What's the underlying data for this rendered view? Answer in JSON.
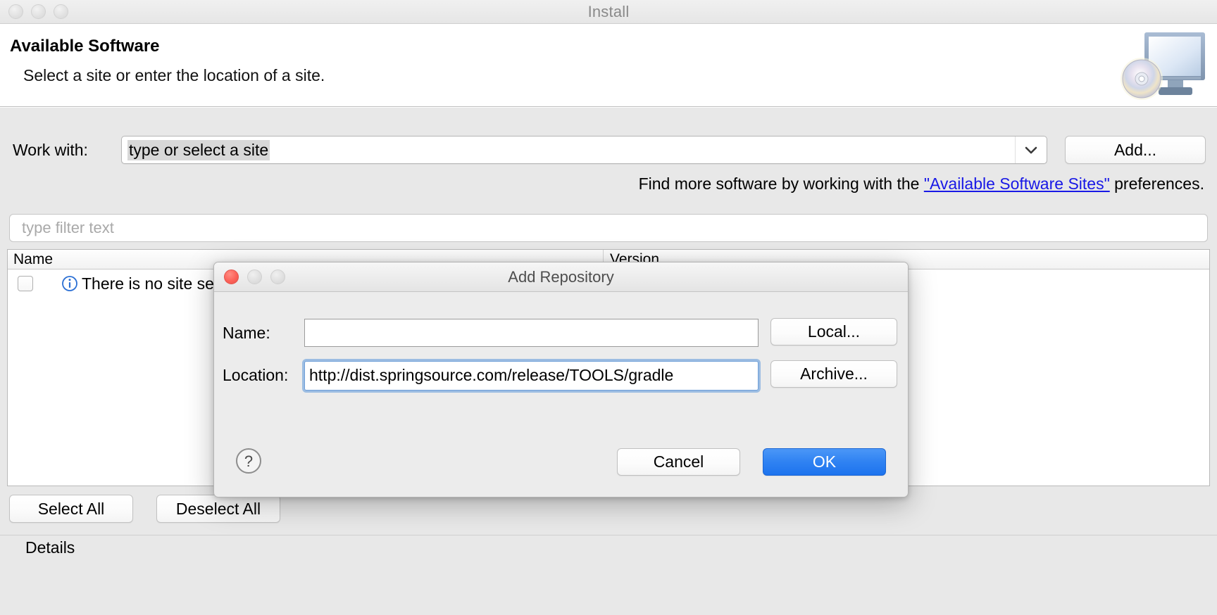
{
  "window": {
    "title": "Install",
    "traffic_lights": [
      "close",
      "minimize",
      "zoom"
    ]
  },
  "banner": {
    "title": "Available Software",
    "subtitle": "Select a site or enter the location of a site.",
    "icon": "install-monitor-cd-icon"
  },
  "form": {
    "work_with_label": "Work with:",
    "work_with_value": "type or select a site",
    "work_with_placeholder": "type or select a site",
    "add_button": "Add...",
    "hint_prefix": "Find more software by working with the ",
    "hint_link": "\"Available Software Sites\"",
    "hint_suffix": " preferences.",
    "filter_placeholder": "type filter text"
  },
  "table": {
    "columns": [
      "Name",
      "Version"
    ],
    "rows": [
      {
        "checked": false,
        "icon": "info-icon",
        "name": "There is no site selected.",
        "version": ""
      }
    ]
  },
  "actions": {
    "select_all": "Select All",
    "deselect_all": "Deselect All",
    "details_label": "Details"
  },
  "dialog": {
    "title": "Add Repository",
    "name_label": "Name:",
    "name_value": "",
    "location_label": "Location:",
    "location_value": "http://dist.springsource.com/release/TOOLS/gradle",
    "local_button": "Local...",
    "archive_button": "Archive...",
    "cancel_button": "Cancel",
    "ok_button": "OK",
    "help_button": "?"
  },
  "colors": {
    "accent_blue": "#2f82f2",
    "link_blue": "#1818e6",
    "focus_ring": "#6aa0dc",
    "close_red": "#fc6259",
    "window_gray": "#e8e8e8"
  }
}
